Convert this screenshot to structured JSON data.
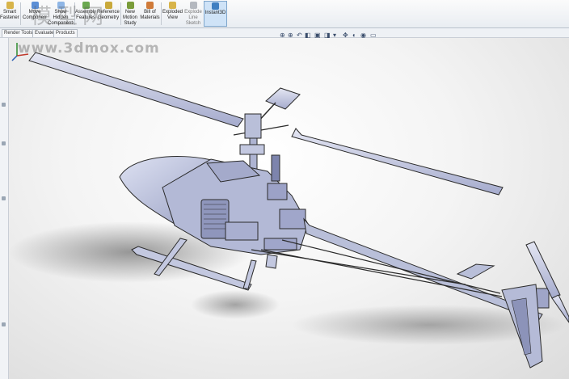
{
  "ribbon": {
    "buttons": [
      {
        "label": "Smart Fasteners",
        "icon": "smart-fasteners-icon"
      },
      {
        "label": "Move Component",
        "icon": "move-component-icon"
      },
      {
        "label": "Show Hidden Components",
        "icon": "show-hidden-icon"
      },
      {
        "label": "Assembly Features",
        "icon": "assembly-features-icon"
      },
      {
        "label": "Reference Geometry",
        "icon": "reference-geometry-icon"
      },
      {
        "label": "New Motion Study",
        "icon": "motion-study-icon"
      },
      {
        "label": "Bill of Materials",
        "icon": "bom-icon"
      },
      {
        "label": "Exploded View",
        "icon": "exploded-view-icon"
      },
      {
        "label": "Explode Line Sketch",
        "icon": "explode-line-icon"
      },
      {
        "label": "Instant3D",
        "icon": "instant3d-icon",
        "active": true
      }
    ]
  },
  "tabs": {
    "items": [
      "Render Tools",
      "Evaluate",
      "Products"
    ]
  },
  "watermark": {
    "text": "www.3dmox.com",
    "cn": "模型网"
  },
  "colors": {
    "accent": "#7fa6cc",
    "model_edge": "#2b2b2b",
    "model_fill": "#b9bfd9"
  }
}
